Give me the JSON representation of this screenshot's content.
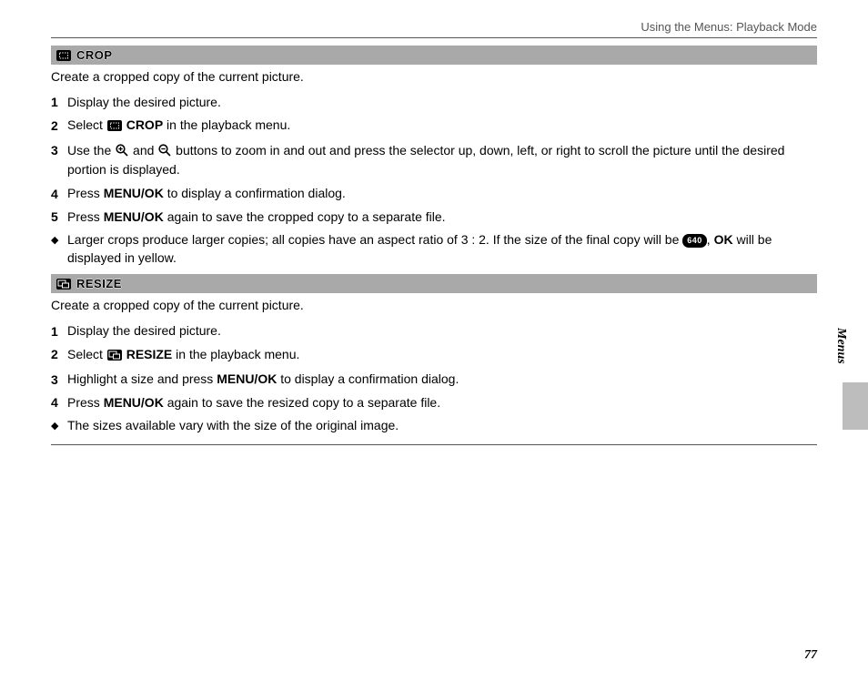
{
  "header": {
    "running": "Using the Menus: Playback Mode"
  },
  "crop": {
    "title": "CROP",
    "intro": "Create a cropped copy of the current picture.",
    "step1": "Display the desired picture.",
    "step2a": "Select ",
    "step2_icon": "crop-icon",
    "step2_label": "CROP",
    "step2b": " in the playback menu.",
    "step3a": "Use the ",
    "step3b": " and ",
    "step3c": " buttons to zoom in and out and press the selector up, down, left, or right to scroll the picture until the desired portion is displayed.",
    "step4a": "Press ",
    "step4_btn": "MENU/OK",
    "step4b": " to display a confirmation dialog.",
    "step5a": "Press ",
    "step5_btn": "MENU/OK",
    "step5b": " again to save the cropped copy to a separate file.",
    "note_a": "Larger crops produce larger copies; all copies have an aspect ratio of 3 : 2.  If the size of the final copy will be ",
    "note_badge": "640",
    "note_b": ", ",
    "note_ok": "OK",
    "note_c": " will be displayed in yellow."
  },
  "resize": {
    "title": "RESIZE",
    "intro": "Create a cropped copy of the current picture.",
    "step1": "Display the desired picture.",
    "step2a": "Select ",
    "step2_icon": "resize-icon",
    "step2_label": "RESIZE",
    "step2b": " in the playback menu.",
    "step3a": "Highlight a size and press ",
    "step3_btn": "MENU/OK",
    "step3b": " to display a confirmation dialog.",
    "step4a": "Press ",
    "step4_btn": "MENU/OK",
    "step4b": " again to save the resized copy to a separate file.",
    "note": "The sizes available vary with the size of the original image."
  },
  "side": {
    "tab": "Menus"
  },
  "page_no": "77"
}
